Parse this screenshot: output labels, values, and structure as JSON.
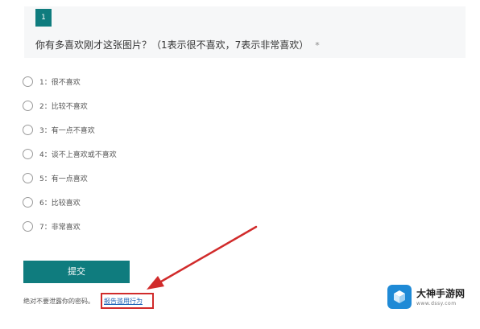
{
  "question": {
    "number": "1",
    "title": "你有多喜欢刚才这张图片？（1表示很不喜欢，7表示非常喜欢）",
    "required_mark": "*"
  },
  "options": [
    {
      "label": "1：很不喜欢"
    },
    {
      "label": "2：比较不喜欢"
    },
    {
      "label": "3：有一点不喜欢"
    },
    {
      "label": "4：谈不上喜欢或不喜欢"
    },
    {
      "label": "5：有一点喜欢"
    },
    {
      "label": "6：比较喜欢"
    },
    {
      "label": "7：非常喜欢"
    }
  ],
  "submit_label": "提交",
  "footer": {
    "note": "绝对不要泄露你的密码。",
    "report_link": "报告滥用行为"
  },
  "watermark": {
    "title": "大神手游网",
    "subtitle": "www.dssy.com"
  },
  "colors": {
    "accent": "#0f7c7e",
    "highlight": "#d12b2b",
    "link": "#1a5fb4"
  }
}
